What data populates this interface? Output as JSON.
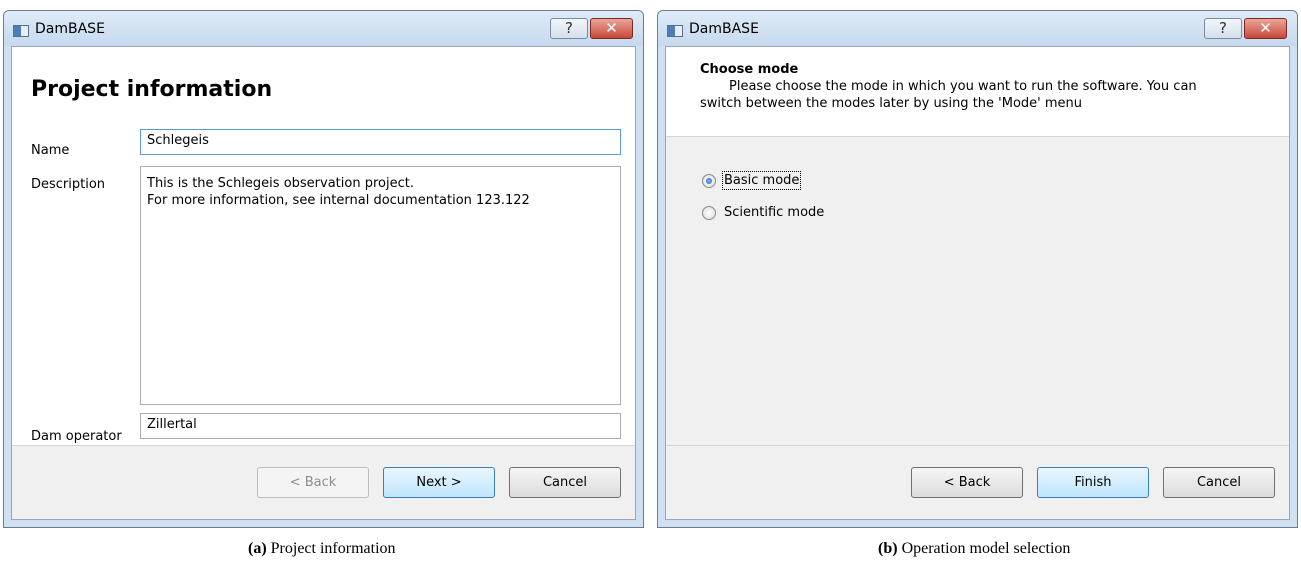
{
  "left_window": {
    "title": "DamBASE",
    "help_label": "?",
    "close_label": "✕",
    "heading": "Project information",
    "name_label": "Name",
    "name_value": "Schlegeis",
    "description_label": "Description",
    "description_lines": [
      "This is the Schlegeis observation project.",
      "For more information, see internal documentation 123.122"
    ],
    "dam_operator_label": "Dam operator",
    "dam_operator_value": "Zillertal",
    "back_label": "< Back",
    "next_label": "Next >",
    "cancel_label": "Cancel"
  },
  "right_window": {
    "title": "DamBASE",
    "help_label": "?",
    "close_label": "✕",
    "header_title": "Choose mode",
    "header_line1": "Please choose the mode in which you want to run the software. You can",
    "header_line2": "switch between the modes later by using the 'Mode' menu",
    "options": [
      {
        "label": "Basic mode",
        "checked": true
      },
      {
        "label": "Scientific mode",
        "checked": false
      }
    ],
    "back_label": "< Back",
    "finish_label": "Finish",
    "cancel_label": "Cancel"
  },
  "captions": {
    "a_tag": "(a)",
    "a_text": "Project information",
    "b_tag": "(b)",
    "b_text": "Operation model selection"
  }
}
